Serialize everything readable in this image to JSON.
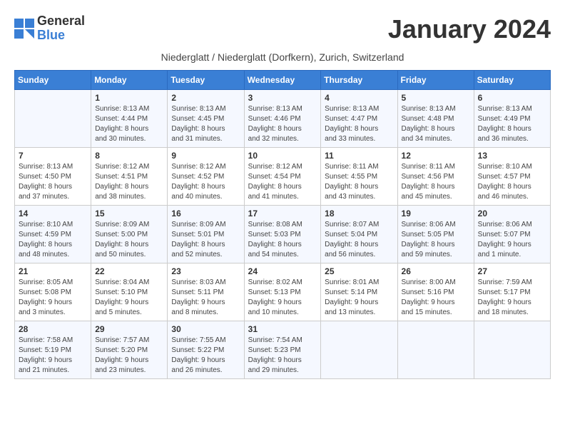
{
  "header": {
    "logo_general": "General",
    "logo_blue": "Blue",
    "title": "January 2024",
    "subtitle": "Niederglatt / Niederglatt (Dorfkern), Zurich, Switzerland"
  },
  "calendar": {
    "days_of_week": [
      "Sunday",
      "Monday",
      "Tuesday",
      "Wednesday",
      "Thursday",
      "Friday",
      "Saturday"
    ],
    "weeks": [
      [
        {
          "day": "",
          "info": ""
        },
        {
          "day": "1",
          "info": "Sunrise: 8:13 AM\nSunset: 4:44 PM\nDaylight: 8 hours\nand 30 minutes."
        },
        {
          "day": "2",
          "info": "Sunrise: 8:13 AM\nSunset: 4:45 PM\nDaylight: 8 hours\nand 31 minutes."
        },
        {
          "day": "3",
          "info": "Sunrise: 8:13 AM\nSunset: 4:46 PM\nDaylight: 8 hours\nand 32 minutes."
        },
        {
          "day": "4",
          "info": "Sunrise: 8:13 AM\nSunset: 4:47 PM\nDaylight: 8 hours\nand 33 minutes."
        },
        {
          "day": "5",
          "info": "Sunrise: 8:13 AM\nSunset: 4:48 PM\nDaylight: 8 hours\nand 34 minutes."
        },
        {
          "day": "6",
          "info": "Sunrise: 8:13 AM\nSunset: 4:49 PM\nDaylight: 8 hours\nand 36 minutes."
        }
      ],
      [
        {
          "day": "7",
          "info": "Sunrise: 8:13 AM\nSunset: 4:50 PM\nDaylight: 8 hours\nand 37 minutes."
        },
        {
          "day": "8",
          "info": "Sunrise: 8:12 AM\nSunset: 4:51 PM\nDaylight: 8 hours\nand 38 minutes."
        },
        {
          "day": "9",
          "info": "Sunrise: 8:12 AM\nSunset: 4:52 PM\nDaylight: 8 hours\nand 40 minutes."
        },
        {
          "day": "10",
          "info": "Sunrise: 8:12 AM\nSunset: 4:54 PM\nDaylight: 8 hours\nand 41 minutes."
        },
        {
          "day": "11",
          "info": "Sunrise: 8:11 AM\nSunset: 4:55 PM\nDaylight: 8 hours\nand 43 minutes."
        },
        {
          "day": "12",
          "info": "Sunrise: 8:11 AM\nSunset: 4:56 PM\nDaylight: 8 hours\nand 45 minutes."
        },
        {
          "day": "13",
          "info": "Sunrise: 8:10 AM\nSunset: 4:57 PM\nDaylight: 8 hours\nand 46 minutes."
        }
      ],
      [
        {
          "day": "14",
          "info": "Sunrise: 8:10 AM\nSunset: 4:59 PM\nDaylight: 8 hours\nand 48 minutes."
        },
        {
          "day": "15",
          "info": "Sunrise: 8:09 AM\nSunset: 5:00 PM\nDaylight: 8 hours\nand 50 minutes."
        },
        {
          "day": "16",
          "info": "Sunrise: 8:09 AM\nSunset: 5:01 PM\nDaylight: 8 hours\nand 52 minutes."
        },
        {
          "day": "17",
          "info": "Sunrise: 8:08 AM\nSunset: 5:03 PM\nDaylight: 8 hours\nand 54 minutes."
        },
        {
          "day": "18",
          "info": "Sunrise: 8:07 AM\nSunset: 5:04 PM\nDaylight: 8 hours\nand 56 minutes."
        },
        {
          "day": "19",
          "info": "Sunrise: 8:06 AM\nSunset: 5:05 PM\nDaylight: 8 hours\nand 59 minutes."
        },
        {
          "day": "20",
          "info": "Sunrise: 8:06 AM\nSunset: 5:07 PM\nDaylight: 9 hours\nand 1 minute."
        }
      ],
      [
        {
          "day": "21",
          "info": "Sunrise: 8:05 AM\nSunset: 5:08 PM\nDaylight: 9 hours\nand 3 minutes."
        },
        {
          "day": "22",
          "info": "Sunrise: 8:04 AM\nSunset: 5:10 PM\nDaylight: 9 hours\nand 5 minutes."
        },
        {
          "day": "23",
          "info": "Sunrise: 8:03 AM\nSunset: 5:11 PM\nDaylight: 9 hours\nand 8 minutes."
        },
        {
          "day": "24",
          "info": "Sunrise: 8:02 AM\nSunset: 5:13 PM\nDaylight: 9 hours\nand 10 minutes."
        },
        {
          "day": "25",
          "info": "Sunrise: 8:01 AM\nSunset: 5:14 PM\nDaylight: 9 hours\nand 13 minutes."
        },
        {
          "day": "26",
          "info": "Sunrise: 8:00 AM\nSunset: 5:16 PM\nDaylight: 9 hours\nand 15 minutes."
        },
        {
          "day": "27",
          "info": "Sunrise: 7:59 AM\nSunset: 5:17 PM\nDaylight: 9 hours\nand 18 minutes."
        }
      ],
      [
        {
          "day": "28",
          "info": "Sunrise: 7:58 AM\nSunset: 5:19 PM\nDaylight: 9 hours\nand 21 minutes."
        },
        {
          "day": "29",
          "info": "Sunrise: 7:57 AM\nSunset: 5:20 PM\nDaylight: 9 hours\nand 23 minutes."
        },
        {
          "day": "30",
          "info": "Sunrise: 7:55 AM\nSunset: 5:22 PM\nDaylight: 9 hours\nand 26 minutes."
        },
        {
          "day": "31",
          "info": "Sunrise: 7:54 AM\nSunset: 5:23 PM\nDaylight: 9 hours\nand 29 minutes."
        },
        {
          "day": "",
          "info": ""
        },
        {
          "day": "",
          "info": ""
        },
        {
          "day": "",
          "info": ""
        }
      ]
    ]
  }
}
